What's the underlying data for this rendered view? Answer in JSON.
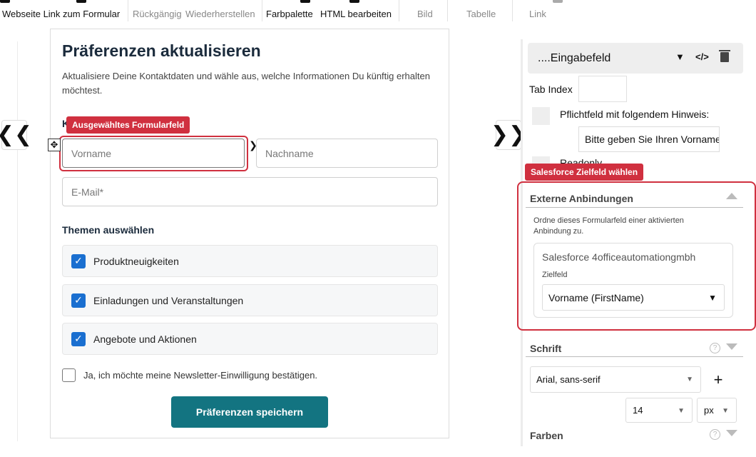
{
  "toolbar": {
    "items": [
      {
        "label": "Webseite Link zum Formular"
      },
      {
        "label": "Rückgängig"
      },
      {
        "label": "Wiederherstellen"
      },
      {
        "label": "Farbpalette"
      },
      {
        "label": "HTML bearbeiten"
      },
      {
        "label": "Bild"
      },
      {
        "label": "Tabelle"
      },
      {
        "label": "Link"
      }
    ]
  },
  "nav": {
    "left_arrow": "❮❮",
    "right_arrow": "❯❯"
  },
  "form": {
    "title": "Präferenzen aktualisieren",
    "description": "Aktualisiere Deine Kontaktdaten und wähle aus, welche Informationen Du künftig erhalten möchtest.",
    "selected_tag": "Ausgewähltes Formularfeld",
    "hidden_heading_letter": "K",
    "firstname_placeholder": "Vorname",
    "lastname_placeholder": "Nachname",
    "email_placeholder": "E-Mail*",
    "topics_heading": "Themen auswählen",
    "topics": [
      {
        "label": "Produktneuigkeiten",
        "checked": true
      },
      {
        "label": "Einladungen und Veranstaltungen",
        "checked": true
      },
      {
        "label": "Angebote und Aktionen",
        "checked": true
      }
    ],
    "newsletter_label": "Ja, ich möchte meine Newsletter-Einwilligung bestätigen.",
    "save_label": "Präferenzen speichern",
    "accent_color": "#137481",
    "check_color": "#1a6fd0"
  },
  "panel": {
    "element_title": "....Eingabefeld",
    "tab_index_label": "Tab Index",
    "required_label": "Pflichtfeld mit folgendem Hinweis:",
    "required_hint_value": "Bitte geben Sie Ihren Vorname",
    "readonly_label": "Readonly",
    "salesforce_tag": "Salesforce Zielfeld wählen",
    "external": {
      "title": "Externe Anbindungen",
      "description": "Ordne dieses Formularfeld einer aktivierten Anbindung zu.",
      "connection_name": "Salesforce 4officeautomationgmbh",
      "target_label": "Zielfeld",
      "target_value": "Vorname (FirstName)"
    },
    "font_section": "Schrift",
    "font_value": "Arial, sans-serif",
    "font_size": "14",
    "font_unit": "px",
    "colors_section": "Farben",
    "highlight_color": "#d0303f"
  }
}
